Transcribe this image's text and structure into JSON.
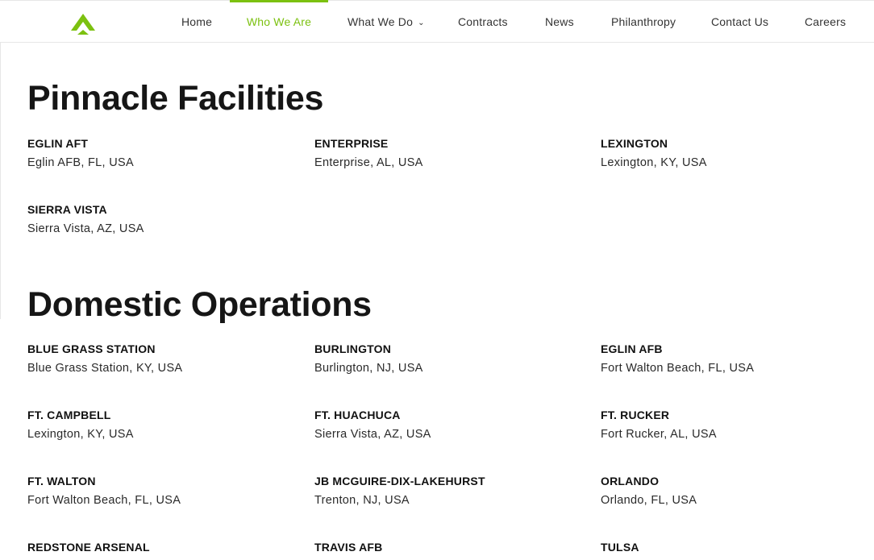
{
  "nav": {
    "items": [
      "Home",
      "Who We Are",
      "What We Do",
      "Contracts",
      "News",
      "Philanthropy",
      "Contact Us",
      "Careers"
    ],
    "active": "Who We Are",
    "accent": "#7cc110"
  },
  "sections": [
    {
      "title": "Pinnacle Facilities",
      "locations": [
        {
          "name": "EGLIN AFT",
          "address": "Eglin AFB, FL, USA"
        },
        {
          "name": "ENTERPRISE",
          "address": "Enterprise, AL, USA"
        },
        {
          "name": "LEXINGTON",
          "address": "Lexington, KY, USA"
        },
        {
          "name": "SIERRA VISTA",
          "address": "Sierra Vista, AZ, USA"
        }
      ]
    },
    {
      "title": "Domestic Operations",
      "locations": [
        {
          "name": "BLUE GRASS STATION",
          "address": "Blue Grass Station, KY, USA"
        },
        {
          "name": "BURLINGTON",
          "address": "Burlington, NJ, USA"
        },
        {
          "name": "EGLIN AFB",
          "address": "Fort Walton Beach, FL, USA"
        },
        {
          "name": "FT. CAMPBELL",
          "address": "Lexington, KY, USA"
        },
        {
          "name": "FT. HUACHUCA",
          "address": "Sierra Vista, AZ, USA"
        },
        {
          "name": "FT. RUCKER",
          "address": "Fort Rucker, AL, USA"
        },
        {
          "name": "FT. WALTON",
          "address": "Fort Walton Beach, FL, USA"
        },
        {
          "name": "JB MCGUIRE-DIX-LAKEHURST",
          "address": "Trenton, NJ, USA"
        },
        {
          "name": "ORLANDO",
          "address": "Orlando, FL, USA"
        },
        {
          "name": "REDSTONE ARSENAL",
          "address": ""
        },
        {
          "name": "TRAVIS AFB",
          "address": ""
        },
        {
          "name": "TULSA",
          "address": ""
        }
      ]
    }
  ]
}
